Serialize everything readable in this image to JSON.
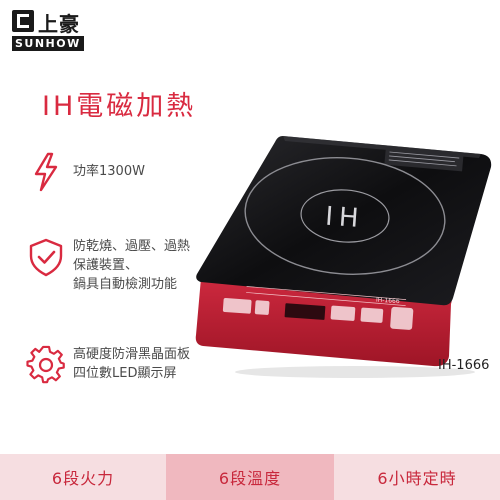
{
  "brand": {
    "name_zh": "上豪",
    "name_en": "SUNHOW"
  },
  "title": "IH電磁加熱",
  "features": [
    {
      "icon": "lightning-icon",
      "lines": [
        "功率1300W"
      ]
    },
    {
      "icon": "shield-check-icon",
      "lines": [
        "防乾燒、過壓、過熱",
        "保護裝置、",
        "鍋具自動檢測功能"
      ]
    },
    {
      "icon": "gear-icon",
      "lines": [
        "高硬度防滑黑晶面板",
        "四位數LED顯示屏"
      ]
    }
  ],
  "product": {
    "center_text": "IH",
    "panel_text": "IH-1666"
  },
  "model": "IH-1666",
  "bottom_bar": [
    {
      "label": "6段火力"
    },
    {
      "label": "6段溫度"
    },
    {
      "label": "6小時定時"
    }
  ],
  "colors": {
    "accent": "#d92a40",
    "body_red": "#c31d34",
    "glass": "#111114",
    "bar_light": "#f6dee1",
    "bar_mid": "#f0b8bf"
  }
}
